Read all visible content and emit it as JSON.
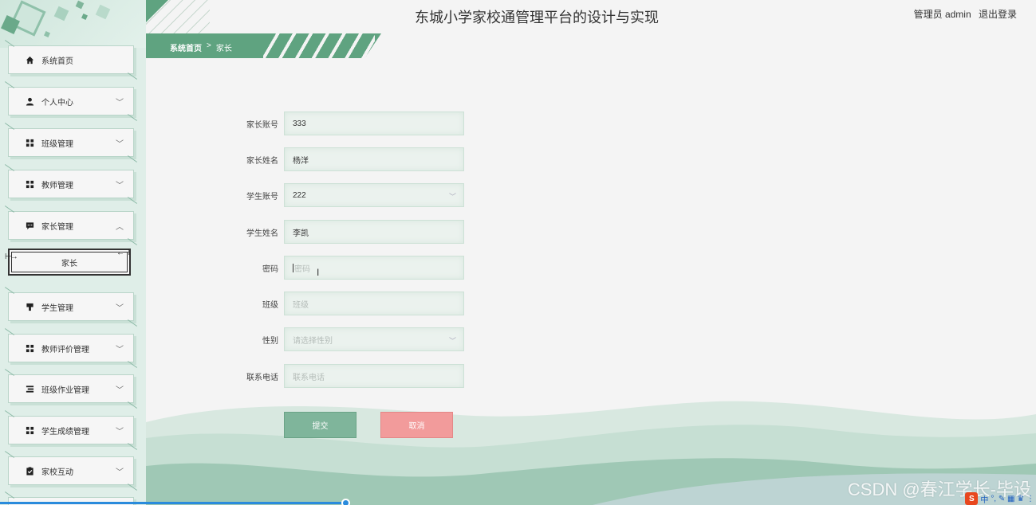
{
  "header": {
    "title": "东城小学家校通管理平台的设计与实现",
    "user_role": "管理员 admin",
    "logout": "退出登录"
  },
  "breadcrumb": {
    "home": "系统首页",
    "separator": ">",
    "current": "家长"
  },
  "sidebar": {
    "items": [
      {
        "label": "系统首页",
        "icon": "home-icon",
        "expandable": false
      },
      {
        "label": "个人中心",
        "icon": "user-icon",
        "expandable": true
      },
      {
        "label": "班级管理",
        "icon": "grid-icon",
        "expandable": true
      },
      {
        "label": "教师管理",
        "icon": "grid-icon",
        "expandable": true
      },
      {
        "label": "家长管理",
        "icon": "chat-icon",
        "expandable": true,
        "expanded": true
      },
      {
        "label": "学生管理",
        "icon": "podium-icon",
        "expandable": true
      },
      {
        "label": "教师评价管理",
        "icon": "grid-icon",
        "expandable": true
      },
      {
        "label": "班级作业管理",
        "icon": "list-icon",
        "expandable": true
      },
      {
        "label": "学生成绩管理",
        "icon": "grid-icon",
        "expandable": true
      },
      {
        "label": "家校互动",
        "icon": "clipboard-icon",
        "expandable": true
      }
    ],
    "sub_item": "家长",
    "chevron_down": "﹀",
    "chevron_up": "︿"
  },
  "form": {
    "parent_account": {
      "label": "家长账号",
      "value": "333"
    },
    "parent_name": {
      "label": "家长姓名",
      "value": "杨洋"
    },
    "student_account": {
      "label": "学生账号",
      "value": "222"
    },
    "student_name": {
      "label": "学生姓名",
      "value": "李凯"
    },
    "password": {
      "label": "密码",
      "placeholder": "密码"
    },
    "class": {
      "label": "班级",
      "placeholder": "班级"
    },
    "gender": {
      "label": "性别",
      "placeholder": "请选择性别"
    },
    "phone": {
      "label": "联系电话",
      "placeholder": "联系电话"
    }
  },
  "buttons": {
    "submit": "提交",
    "cancel": "取消"
  },
  "watermark": "CSDN @春江学长-毕设",
  "tray": {
    "ime": "S",
    "lang": "中",
    "icons": "°, ✎ ▦ ♛ ⋮"
  },
  "colors": {
    "accent": "#5fa380",
    "submit": "#7fb59b",
    "cancel": "#f29b9b",
    "sidebar_bg": "#dfeee8"
  }
}
